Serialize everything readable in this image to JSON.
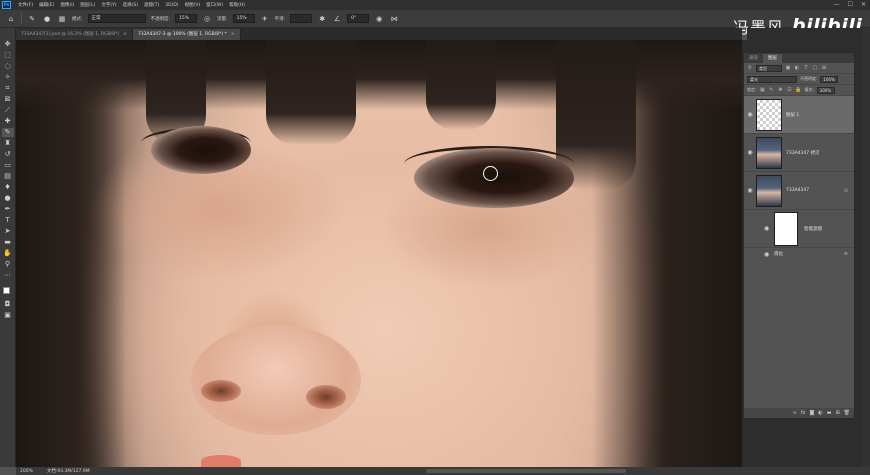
{
  "menu": {
    "logo": "Ps",
    "items": [
      "文件(F)",
      "编辑(E)",
      "图像(I)",
      "图层(L)",
      "文字(Y)",
      "选择(S)",
      "滤镜(T)",
      "3D(D)",
      "视图(V)",
      "窗口(W)",
      "帮助(H)"
    ],
    "window_controls": [
      "—",
      "☐",
      "✕"
    ]
  },
  "options": {
    "mode_label": "模式:",
    "mode_value": "正常",
    "opacity_label": "不透明度:",
    "opacity_value": "15%",
    "flow_label": "流量:",
    "flow_value": "15%",
    "smooth_label": "平滑:",
    "angle_value": "0°"
  },
  "watermark": {
    "author": "冯墨风",
    "brand": "bilibili"
  },
  "tabs": [
    {
      "label": "733A4347[1].psd @ 16.2% (图层 1, RGB/8*)",
      "active": false
    },
    {
      "label": "733A4347-3 @ 100% (图层 1, RGB/8*) *",
      "active": true
    }
  ],
  "status": {
    "zoom": "200%",
    "doc": "文档:93.3M/127.9M"
  },
  "layers_panel": {
    "tabs": [
      "通道",
      "图层"
    ],
    "filter_kind": "类型",
    "blend_mode": "柔光",
    "opacity_label": "不透明度:",
    "opacity_value": "100%",
    "lock_label": "锁定:",
    "fill_label": "填充:",
    "fill_value": "100%",
    "layers": [
      {
        "name": "图层 1",
        "thumb": "transparent",
        "selected": true
      },
      {
        "name": "733A4347 拷贝",
        "thumb": "photo",
        "selected": false
      },
      {
        "name": "733A4347",
        "thumb": "photo",
        "selected": false
      }
    ],
    "smart_filter_label": "智能滤镜",
    "filter_name": "液化"
  },
  "toolbar": {
    "tools": [
      "move-icon",
      "marquee-icon",
      "lasso-icon",
      "quick-select-icon",
      "crop-icon",
      "frame-icon",
      "eyedropper-icon",
      "healing-icon",
      "brush-icon",
      "stamp-icon",
      "history-brush-icon",
      "eraser-icon",
      "gradient-icon",
      "blur-icon",
      "dodge-icon",
      "pen-icon",
      "type-icon",
      "path-select-icon",
      "rectangle-icon",
      "hand-icon",
      "zoom-icon"
    ]
  }
}
